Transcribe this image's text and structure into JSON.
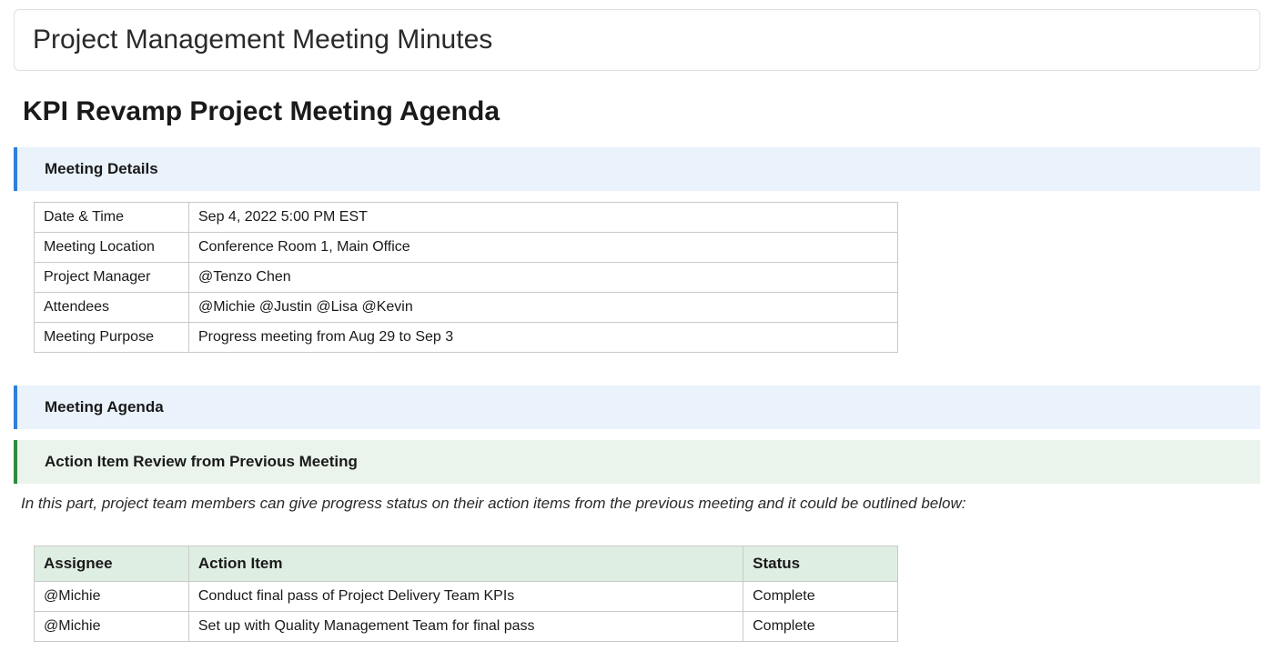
{
  "card_title": "Project Management Meeting Minutes",
  "page_title": "KPI Revamp Project Meeting Agenda",
  "sections": {
    "meeting_details": "Meeting Details",
    "meeting_agenda": "Meeting Agenda",
    "action_review": "Action Item Review from Previous Meeting"
  },
  "details": {
    "rows": [
      {
        "label": "Date & Time",
        "value": "Sep 4, 2022 5:00 PM EST"
      },
      {
        "label": "Meeting Location",
        "value": "Conference Room 1, Main Office"
      },
      {
        "label": "Project Manager",
        "value": "@Tenzo Chen"
      },
      {
        "label": "Attendees",
        "value": "@Michie @Justin @Lisa @Kevin"
      },
      {
        "label": "Meeting Purpose",
        "value": "Progress meeting from Aug 29 to Sep 3"
      }
    ]
  },
  "note": "In this part, project team members can give progress status on their action items from the previous meeting and it could be outlined below:",
  "action_table": {
    "headers": {
      "assignee": "Assignee",
      "item": "Action Item",
      "status": "Status"
    },
    "rows": [
      {
        "assignee": "@Michie",
        "item": "Conduct final pass of Project Delivery Team KPIs",
        "status": "Complete"
      },
      {
        "assignee": "@Michie",
        "item": "Set up with Quality Management Team for final pass",
        "status": "Complete"
      }
    ]
  }
}
